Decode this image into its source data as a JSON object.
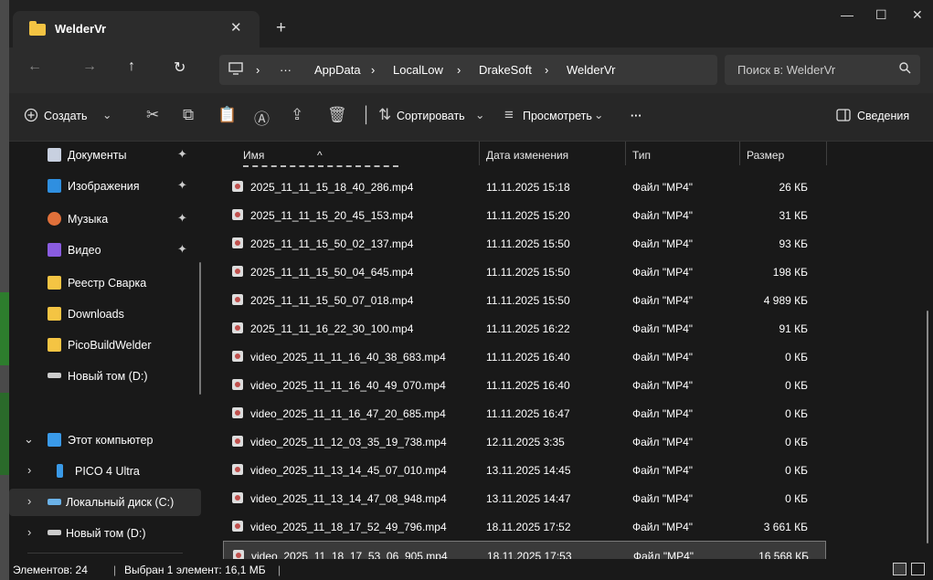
{
  "window": {
    "title": "WelderVr",
    "close_glyph": "✕",
    "new_tab_glyph": "+"
  },
  "controls": {
    "minimize": "—",
    "maximize": "☐",
    "close": "✕"
  },
  "nav": {
    "back": "←",
    "forward": "→",
    "up": "↑",
    "refresh": "↻"
  },
  "address": {
    "more": "···",
    "sep": "›",
    "crumbs": [
      "AppData",
      "LocalLow",
      "DrakeSoft",
      "WelderVr"
    ]
  },
  "search": {
    "placeholder": "Поиск в: WelderVr",
    "icon": "search-icon"
  },
  "toolbar": {
    "create": "Создать",
    "sort": "Сортировать",
    "view": "Просмотреть",
    "more": "···",
    "details": "Сведения",
    "dropdown": "⌄"
  },
  "sidebar": {
    "pin": "📌",
    "items": [
      {
        "label": "Документы",
        "pinned": true,
        "color": "#c8d0e0"
      },
      {
        "label": "Изображения",
        "pinned": true,
        "color": "#2f8fe0"
      },
      {
        "label": "Музыка",
        "pinned": true,
        "color": "#e0703a"
      },
      {
        "label": "Видео",
        "pinned": true,
        "color": "#8a5ce0"
      },
      {
        "label": "Реестр Сварка",
        "color": "#f4c443"
      },
      {
        "label": "Downloads",
        "color": "#f4c443"
      },
      {
        "label": "PicoBuildWelder",
        "color": "#f4c443"
      },
      {
        "label": "Новый том (D:)",
        "color": "#cccccc"
      }
    ],
    "tree": [
      {
        "label": "Этот компьютер",
        "chevron": "⌄",
        "color": "#3a9ae8"
      },
      {
        "label": "PICO 4 Ultra",
        "chevron": "›",
        "color": "#3a9ae8"
      },
      {
        "label": "Локальный диск (C:)",
        "chevron": "›",
        "color": "#6bb2e8",
        "selected": true
      },
      {
        "label": "Новый том (D:)",
        "chevron": "›",
        "color": "#cccccc"
      }
    ]
  },
  "columns": {
    "name": "Имя",
    "date": "Дата изменения",
    "type": "Тип",
    "size": "Размер"
  },
  "files": [
    {
      "name": "2025_11_11_15_18_40_286.mp4",
      "date": "11.11.2025 15:18",
      "type": "Файл \"MP4\"",
      "size": "26 КБ"
    },
    {
      "name": "2025_11_11_15_20_45_153.mp4",
      "date": "11.11.2025 15:20",
      "type": "Файл \"MP4\"",
      "size": "31 КБ"
    },
    {
      "name": "2025_11_11_15_50_02_137.mp4",
      "date": "11.11.2025 15:50",
      "type": "Файл \"MP4\"",
      "size": "93 КБ"
    },
    {
      "name": "2025_11_11_15_50_04_645.mp4",
      "date": "11.11.2025 15:50",
      "type": "Файл \"MP4\"",
      "size": "198 КБ"
    },
    {
      "name": "2025_11_11_15_50_07_018.mp4",
      "date": "11.11.2025 15:50",
      "type": "Файл \"MP4\"",
      "size": "4 989 КБ"
    },
    {
      "name": "2025_11_11_16_22_30_100.mp4",
      "date": "11.11.2025 16:22",
      "type": "Файл \"MP4\"",
      "size": "91 КБ"
    },
    {
      "name": "video_2025_11_11_16_40_38_683.mp4",
      "date": "11.11.2025 16:40",
      "type": "Файл \"MP4\"",
      "size": "0 КБ"
    },
    {
      "name": "video_2025_11_11_16_40_49_070.mp4",
      "date": "11.11.2025 16:40",
      "type": "Файл \"MP4\"",
      "size": "0 КБ"
    },
    {
      "name": "video_2025_11_11_16_47_20_685.mp4",
      "date": "11.11.2025 16:47",
      "type": "Файл \"MP4\"",
      "size": "0 КБ"
    },
    {
      "name": "video_2025_11_12_03_35_19_738.mp4",
      "date": "12.11.2025 3:35",
      "type": "Файл \"MP4\"",
      "size": "0 КБ"
    },
    {
      "name": "video_2025_11_13_14_45_07_010.mp4",
      "date": "13.11.2025 14:45",
      "type": "Файл \"MP4\"",
      "size": "0 КБ"
    },
    {
      "name": "video_2025_11_13_14_47_08_948.mp4",
      "date": "13.11.2025 14:47",
      "type": "Файл \"MP4\"",
      "size": "0 КБ"
    },
    {
      "name": "video_2025_11_18_17_52_49_796.mp4",
      "date": "18.11.2025 17:52",
      "type": "Файл \"MP4\"",
      "size": "3 661 КБ"
    },
    {
      "name": "video_2025_11_18_17_53_06_905.mp4",
      "date": "18.11.2025 17:53",
      "type": "Файл \"MP4\"",
      "size": "16 568 КБ",
      "selected": true
    }
  ],
  "status": {
    "count": "Элементов: 24",
    "sep": "|",
    "selection": "Выбран 1 элемент: 16,1 МБ",
    "sep2": "|"
  }
}
